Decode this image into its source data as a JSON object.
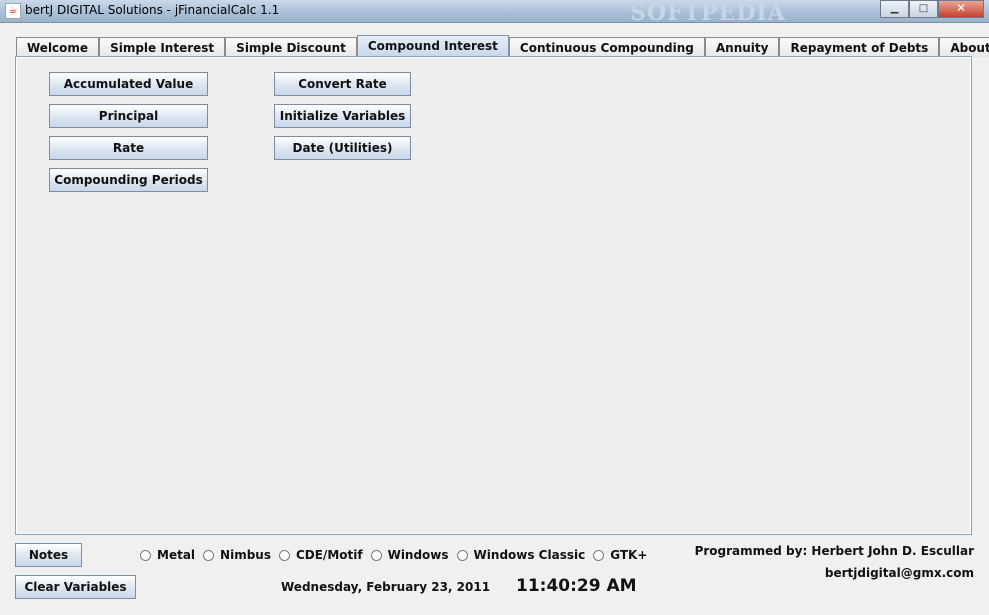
{
  "window": {
    "title": "bertJ DIGITAL Solutions - jFinancialCalc 1.1",
    "watermark": "SOFTPEDIA",
    "minimize": "▁",
    "maximize": "□",
    "close": "✕"
  },
  "tabs": [
    "Welcome",
    "Simple Interest",
    "Simple Discount",
    "Compound Interest",
    "Continuous Compounding",
    "Annuity",
    "Repayment of Debts",
    "About"
  ],
  "active_tab": "Compound Interest",
  "panel": {
    "left_buttons": [
      "Accumulated Value",
      "Principal",
      "Rate",
      "Compounding Periods"
    ],
    "right_buttons": [
      "Convert Rate",
      "Initialize Variables",
      "Date (Utilities)"
    ]
  },
  "footer": {
    "notes_label": "Notes",
    "clear_label": "Clear Variables",
    "themes": [
      "Metal",
      "Nimbus",
      "CDE/Motif",
      "Windows",
      "Windows Classic",
      "GTK+"
    ],
    "date": "Wednesday, February 23, 2011",
    "time": "11:40:29 AM",
    "programmer": "Programmed by: Herbert John D. Escullar",
    "email": "bertjdigital@gmx.com"
  }
}
